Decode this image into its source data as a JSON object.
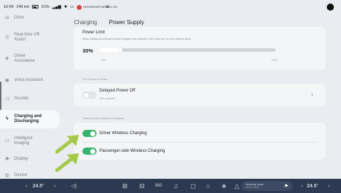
{
  "status_bar": {
    "time": "16:09",
    "range": "249 km",
    "battery": "51%",
    "signal": "ᵃₗₗ",
    "airbag": "PASSENGER AIRBAG ON"
  },
  "sidebar": {
    "items": [
      {
        "label": "Drive",
        "icon": "steering-wheel-icon"
      },
      {
        "label": "Real-time VR Assist",
        "icon": "vr-assist-icon"
      },
      {
        "label": "Driver Assistance",
        "icon": "driver-assistance-icon"
      },
      {
        "label": "Voice Assistant",
        "icon": "voice-assistant-icon"
      },
      {
        "label": "Sounds",
        "icon": "speaker-icon"
      },
      {
        "label": "Charging and Discharging",
        "icon": "charging-icon"
      },
      {
        "label": "Intelligent Imaging",
        "icon": "camera-icon"
      },
      {
        "label": "Display",
        "icon": "brightness-icon"
      },
      {
        "label": "Device",
        "icon": "device-icon"
      }
    ]
  },
  "tabs": [
    "Charging",
    "Power Supply"
  ],
  "power_limit": {
    "title": "Power Limit",
    "description": "Allow setting an external power supply limit between 30% and the current battery level.",
    "value": "30%",
    "level": 0.12,
    "min_label": "30%",
    "max_label": "100%"
  },
  "usb_section": {
    "label": "12V Power in Trunk",
    "delayed_power_off": "Delayed Power Off",
    "status": "Not enabled",
    "enabled": false
  },
  "wireless_section": {
    "label": "Smart Device Wireless Charging",
    "driver": "Driver Wireless Charging",
    "passenger": "Passenger-side Wireless Charging",
    "driver_enabled": true,
    "passenger_enabled": true
  },
  "dock": {
    "left_temp": "24.5",
    "right_temp": "24.5",
    "temp_unit": "°",
    "media_line1": "Anything, Anyw...",
    "media_line2": "Stereo Naro"
  },
  "colors": {
    "accent": "#2aa69a",
    "toggle_on": "#39b36f",
    "dock_bg": "#2d3950",
    "arrow": "#a6c94a"
  }
}
